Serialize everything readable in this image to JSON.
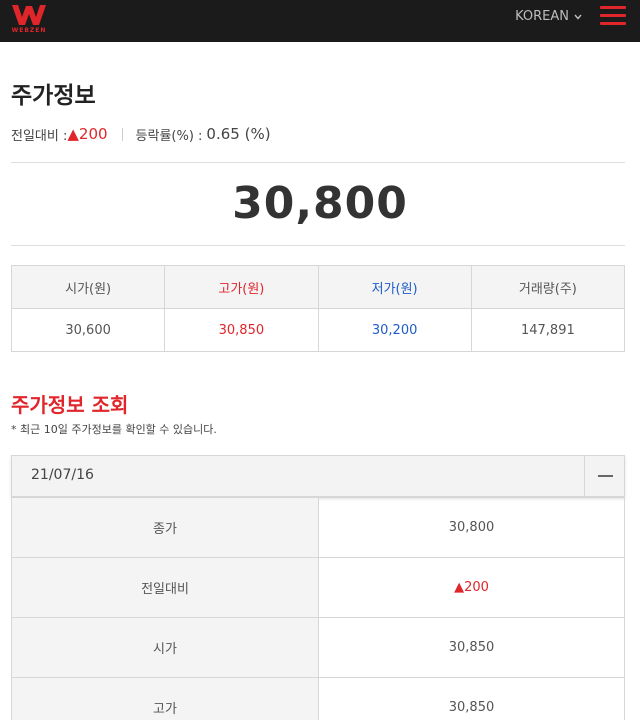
{
  "header": {
    "logo_text": "WEBZEN",
    "language": "KOREAN",
    "brand_color": "#e0262b",
    "menu_icon": "hamburger-icon"
  },
  "page": {
    "title": "주가정보",
    "change_label": "전일대비 :",
    "change_value": "▲200",
    "rate_label": "등락률(%) :",
    "rate_value": "0.65 (%)",
    "current_price": "30,800"
  },
  "summary": {
    "headers": [
      "시가(원)",
      "고가(원)",
      "저가(원)",
      "거래량(주)"
    ],
    "values": [
      "30,600",
      "30,850",
      "30,200",
      "147,891"
    ]
  },
  "history": {
    "title": "주가정보 조회",
    "note": "* 최근 10일 주가정보를 확인할 수 있습니다.",
    "date": "21/07/16",
    "rows": [
      {
        "label": "종가",
        "value": "30,800"
      },
      {
        "label": "전일대비",
        "value": "▲200"
      },
      {
        "label": "시가",
        "value": "30,850"
      },
      {
        "label": "고가",
        "value": "30,850"
      }
    ]
  },
  "colors": {
    "up": "#e0262b",
    "down": "#1f5cc9",
    "header_bg": "#1b1b1b"
  }
}
